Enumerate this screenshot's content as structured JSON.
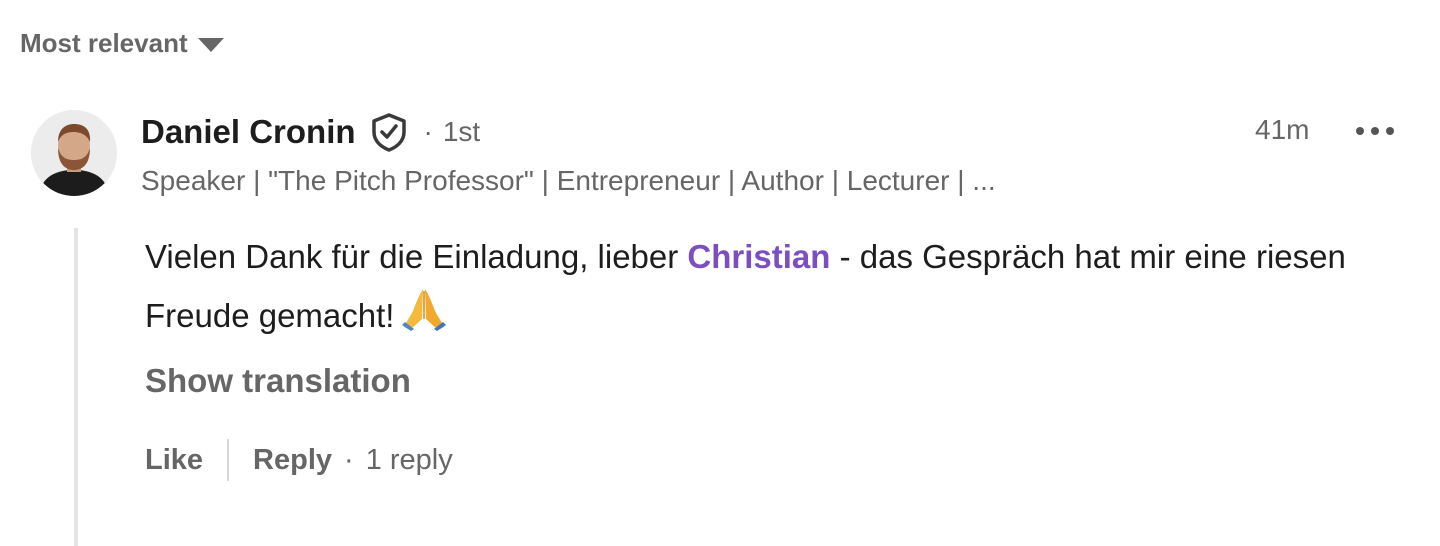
{
  "sort": {
    "label": "Most relevant",
    "icon": "caret-down-icon"
  },
  "comment": {
    "author": {
      "name": "Daniel Cronin",
      "verified_icon": "verified-shield-icon",
      "degree_separator": "·",
      "degree": "1st",
      "headline": "Speaker | \"The Pitch Professor\" | Entrepreneur | Author | Lecturer | ...",
      "avatar_icon": "avatar"
    },
    "time": "41m",
    "more_icon": "ellipsis-icon",
    "text_before_mention": "Vielen Dank für die Einladung, lieber ",
    "mention": "Christian",
    "text_after_mention": " - das Gespräch hat mir eine riesen Freude gemacht!",
    "emoji": "folded-hands-emoji",
    "show_translation": "Show translation",
    "actions": {
      "like": "Like",
      "reply": "Reply",
      "separator": "·",
      "reply_count": "1 reply"
    }
  },
  "colors": {
    "mention": "#7b4fc0",
    "muted_text": "#666666",
    "primary_text": "#1d1d1d"
  }
}
